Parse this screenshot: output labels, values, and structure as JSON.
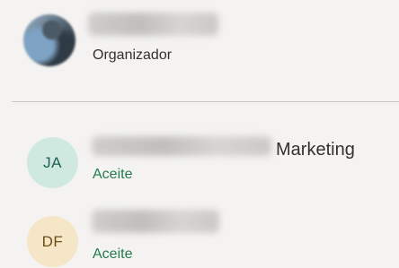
{
  "organizer": {
    "role": "Organizador"
  },
  "attendees": [
    {
      "initials": "JA",
      "department": "Marketing",
      "status": "Aceite",
      "status_color": "#237b4b",
      "avatar_color": "#cfe9e1"
    },
    {
      "initials": "DF",
      "status": "Aceite",
      "status_color": "#237b4b",
      "avatar_color": "#f5e6c8"
    }
  ]
}
